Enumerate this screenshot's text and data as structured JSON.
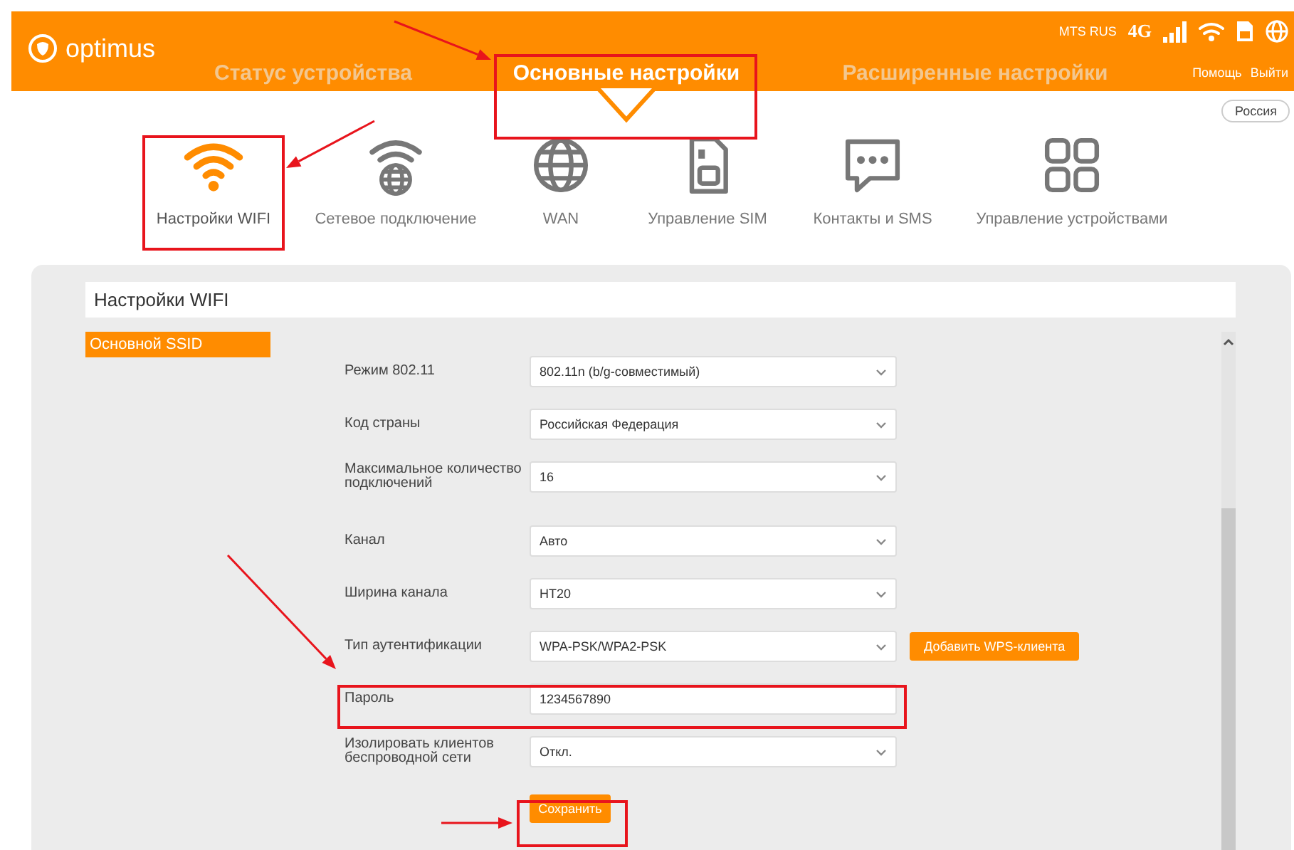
{
  "header": {
    "logo": "optimus",
    "operator": "MTS RUS",
    "network": "4G",
    "links": [
      "Помощь",
      "Выйти"
    ],
    "tabs": [
      {
        "label": "Статус устройства",
        "selected": false
      },
      {
        "label": "Основные настройки",
        "selected": true
      },
      {
        "label": "Расширенные настройки",
        "selected": false
      }
    ]
  },
  "language": "Россия",
  "categories": [
    {
      "kind": "wifi",
      "label": "Настройки WIFI",
      "selected": true
    },
    {
      "kind": "network",
      "label": "Сетевое подключение",
      "selected": false
    },
    {
      "kind": "globe",
      "label": "WAN",
      "selected": false
    },
    {
      "kind": "sim",
      "label": "Управление SIM",
      "selected": false
    },
    {
      "kind": "chat",
      "label": "Контакты и SMS",
      "selected": false
    },
    {
      "kind": "grid",
      "label": "Управление устройствами",
      "selected": false
    }
  ],
  "panel": {
    "title": "Настройки WIFI",
    "side_tabs": [
      {
        "label": "Основной SSID",
        "selected": true
      }
    ],
    "fields": [
      {
        "kind": "select",
        "label": "Режим 802.11",
        "value": "802.11n (b/g-совместимый)"
      },
      {
        "kind": "select",
        "label": "Код страны",
        "value": "Российская Федерация"
      },
      {
        "kind": "select",
        "label": "Максимальное количество подключений",
        "value": "16"
      },
      {
        "kind": "select",
        "label": "Канал",
        "value": "Авто"
      },
      {
        "kind": "select",
        "label": "Ширина канала",
        "value": "HT20"
      },
      {
        "kind": "select",
        "label": "Тип аутентификации",
        "value": "WPA-PSK/WPA2-PSK",
        "button": "Добавить WPS-клиента"
      },
      {
        "kind": "text",
        "label": "Пароль",
        "value": "1234567890"
      },
      {
        "kind": "select",
        "label": "Изолировать клиентов беспроводной сети",
        "value": "Откл."
      }
    ],
    "save_button": "Сохранить"
  }
}
